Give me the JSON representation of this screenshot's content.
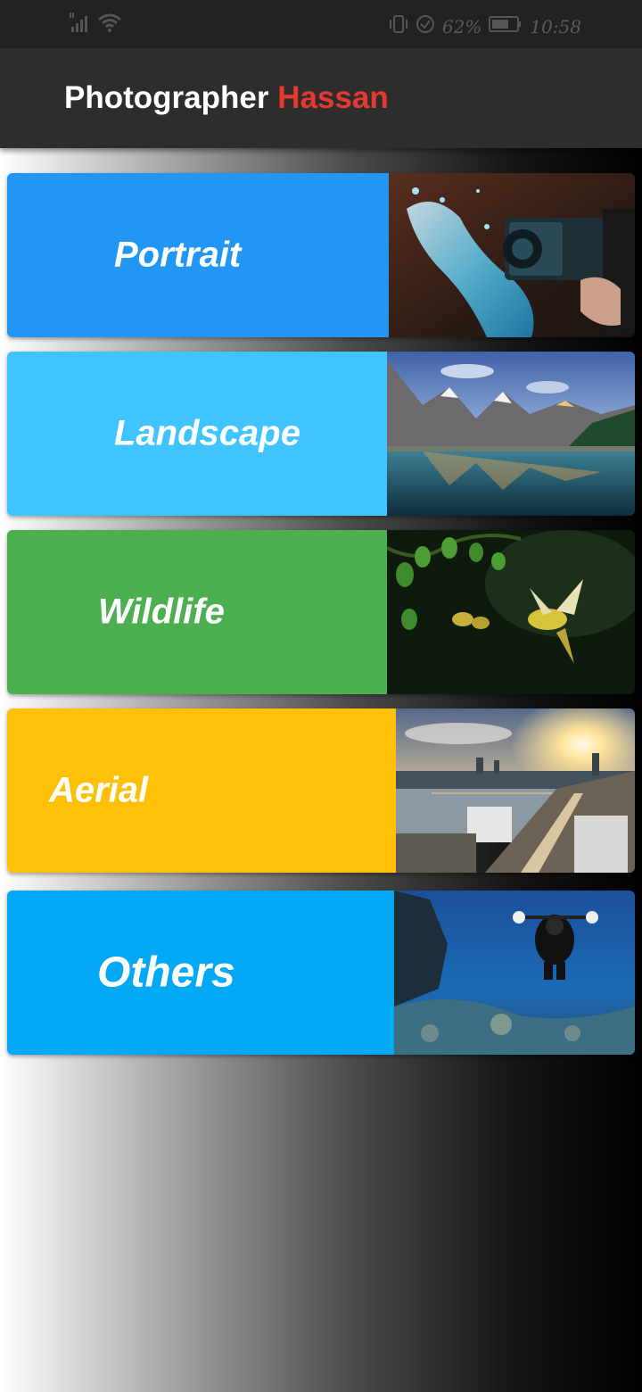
{
  "status_bar": {
    "battery_percent": "62%",
    "time": "10:58"
  },
  "app_bar": {
    "title_first": "Photographer",
    "title_second": "Hassan",
    "accent_color": "#e5392f"
  },
  "categories": [
    {
      "label": "Portrait",
      "color": "#2196f3"
    },
    {
      "label": "Landscape",
      "color": "#40c4ff"
    },
    {
      "label": "Wildlife",
      "color": "#4caf50"
    },
    {
      "label": "Aerial",
      "color": "#ffc107"
    },
    {
      "label": "Others",
      "color": "#03a9f4"
    }
  ]
}
